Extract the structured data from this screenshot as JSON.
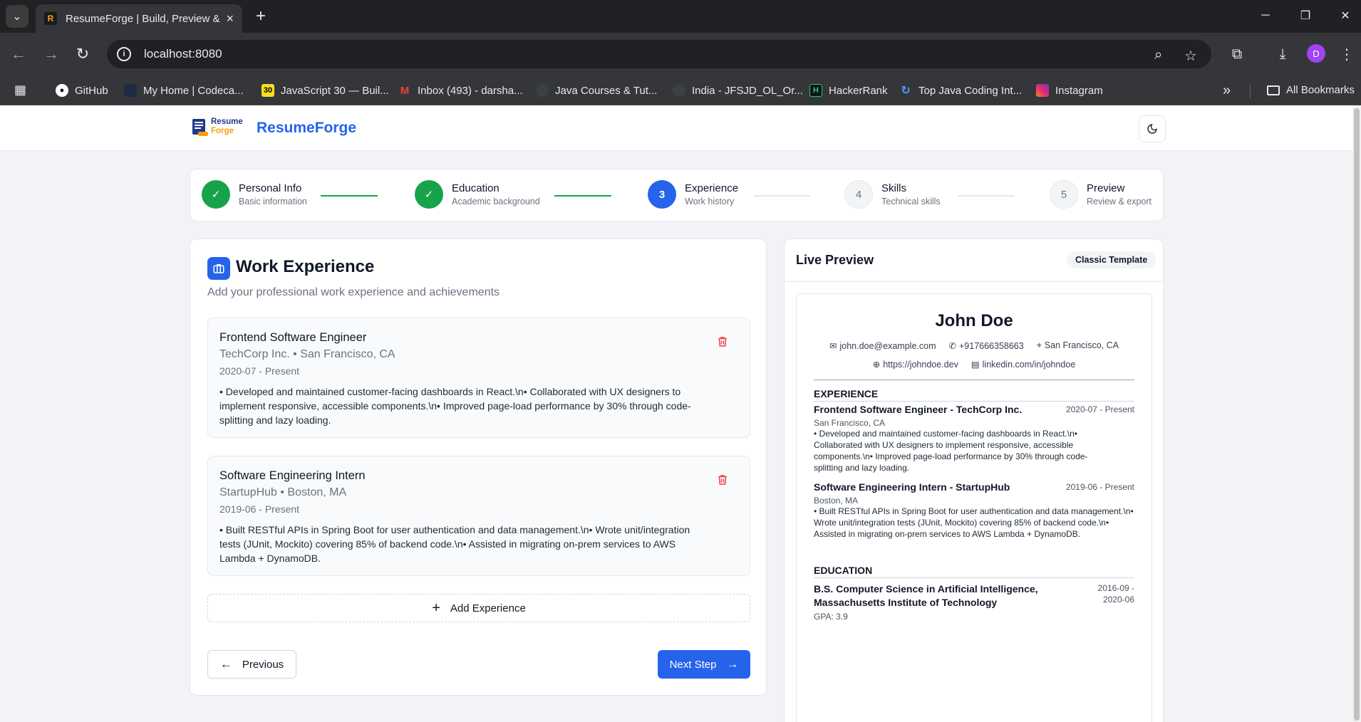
{
  "browser": {
    "tab_title": "ResumeForge | Build, Preview &",
    "url": "localhost:8080",
    "profile_initial": "D",
    "bookmarks": [
      {
        "label": "GitHub",
        "icon": "github-icon"
      },
      {
        "label": "My Home | Codeca...",
        "icon": "codecademy-icon"
      },
      {
        "label": "JavaScript 30 — Buil...",
        "icon": "js30-icon"
      },
      {
        "label": "Inbox (493) - darsha...",
        "icon": "gmail-icon"
      },
      {
        "label": "Java Courses & Tut...",
        "icon": "globe-icon"
      },
      {
        "label": "India - JFSJD_OL_Or...",
        "icon": "globe-icon"
      },
      {
        "label": "HackerRank",
        "icon": "hackerrank-icon"
      },
      {
        "label": "Top Java Coding Int...",
        "icon": "refresh-icon"
      },
      {
        "label": "Instagram",
        "icon": "instagram-icon"
      }
    ],
    "all_bookmarks": "All Bookmarks"
  },
  "app": {
    "brand": "ResumeForge",
    "logo_top": "Resume",
    "logo_bottom": "Forge"
  },
  "steps": [
    {
      "number": "1",
      "title": "Personal Info",
      "subtitle": "Basic information",
      "status": "done"
    },
    {
      "number": "2",
      "title": "Education",
      "subtitle": "Academic background",
      "status": "done"
    },
    {
      "number": "3",
      "title": "Experience",
      "subtitle": "Work history",
      "status": "active"
    },
    {
      "number": "4",
      "title": "Skills",
      "subtitle": "Technical skills",
      "status": "todo"
    },
    {
      "number": "5",
      "title": "Preview",
      "subtitle": "Review & export",
      "status": "todo"
    }
  ],
  "form": {
    "title": "Work Experience",
    "subtitle": "Add your professional work experience and achievements",
    "experiences": [
      {
        "title": "Frontend Software Engineer",
        "company_location": "TechCorp Inc. • San Francisco, CA",
        "dates": "2020-07 - Present",
        "description": "• Developed and maintained customer-facing dashboards in React.\\n• Collaborated with UX designers to implement responsive, accessible components.\\n• Improved page-load performance by 30% through code-splitting and lazy loading."
      },
      {
        "title": "Software Engineering Intern",
        "company_location": "StartupHub • Boston, MA",
        "dates": "2019-06 - Present",
        "description": "• Built RESTful APIs in Spring Boot for user authentication and data management.\\n• Wrote unit/integration tests (JUnit, Mockito) covering 85% of backend code.\\n• Assisted in migrating on-prem services to AWS Lambda + DynamoDB."
      }
    ],
    "add_label": "Add Experience",
    "previous_label": "Previous",
    "next_label": "Next Step"
  },
  "preview": {
    "title": "Live Preview",
    "template_badge": "Classic Template",
    "resume": {
      "name": "John Doe",
      "email": "john.doe@example.com",
      "phone": "+917666358663",
      "location": "San Francisco, CA",
      "website": "https://johndoe.dev",
      "linkedin": "linkedin.com/in/johndoe",
      "experience_heading": "EXPERIENCE",
      "experiences": [
        {
          "heading": "Frontend Software Engineer - TechCorp Inc.",
          "dates": "2020-07 - Present",
          "location": "San Francisco, CA",
          "description": "• Developed and maintained customer-facing dashboards in React.\\n• Collaborated with UX designers to implement responsive, accessible components.\\n• Improved page-load performance by 30% through code-splitting and lazy loading."
        },
        {
          "heading": "Software Engineering Intern - StartupHub",
          "dates": "2019-06 - Present",
          "location": "Boston, MA",
          "description": "• Built RESTful APIs in Spring Boot for user authentication and data management.\\n• Wrote unit/integration tests (JUnit, Mockito) covering 85% of backend code.\\n• Assisted in migrating on-prem services to AWS Lambda + DynamoDB."
        }
      ],
      "education_heading": "EDUCATION",
      "education": {
        "heading": "B.S. Computer Science in Artificial Intelligence, Massachusetts Institute of Technology",
        "dates": "2016-09 - 2020-06",
        "gpa": "GPA: 3.9"
      }
    }
  },
  "colors": {
    "primary": "#2563eb",
    "success": "#16a34a",
    "danger": "#ef4444"
  }
}
